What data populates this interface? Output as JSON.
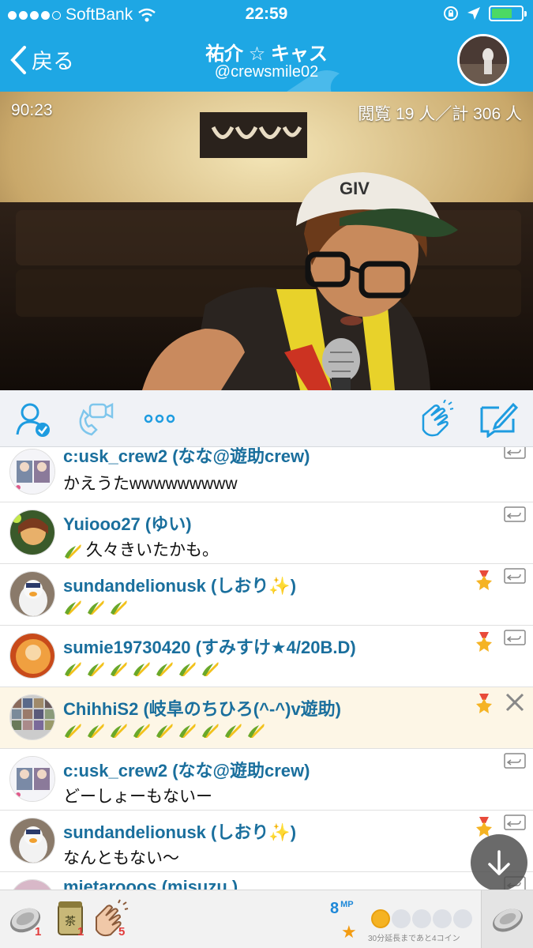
{
  "status_bar": {
    "carrier": "SoftBank",
    "time": "22:59"
  },
  "nav": {
    "back_label": "戻る",
    "title": "祐介 ☆ キャス",
    "subtitle": "@crewsmile02"
  },
  "video": {
    "elapsed": "90:23",
    "viewers": "閲覧 19 人／計 306 人"
  },
  "comments": [
    {
      "name": "c:usk_crew2 (なな@遊助crew)",
      "text": "かえうたwwwwwwwww",
      "corn": 0,
      "medal": false,
      "highlight": false
    },
    {
      "name": "Yuiooo27 (ゆい)",
      "text": "久々きいたかも。",
      "corn": 1,
      "medal": false,
      "highlight": false
    },
    {
      "name": "sundandelionusk (しおり✨)",
      "text": "",
      "corn": 3,
      "medal": true,
      "highlight": false
    },
    {
      "name": "sumie19730420 (すみすけ★4/20B.D)",
      "text": "",
      "corn": 7,
      "medal": true,
      "highlight": false
    },
    {
      "name": "ChihhiS2 (岐阜のちひろ(^-^)v遊助)",
      "text": "",
      "corn": 8,
      "medal": true,
      "highlight": true
    },
    {
      "name": "c:usk_crew2 (なな@遊助crew)",
      "text": "どーしょーもないー",
      "corn": 0,
      "medal": false,
      "highlight": false
    },
    {
      "name": "sundandelionusk (しおり✨)",
      "text": "なんともない〜",
      "corn": 0,
      "medal": true,
      "highlight": false
    },
    {
      "name": "mietarooos (misuzu.)",
      "text": "",
      "corn": 0,
      "medal": false,
      "highlight": false
    }
  ],
  "bottom_bar": {
    "item1_count": "1",
    "item2_count": "1",
    "item2_label": "茶",
    "item3_count": "5",
    "mp_value": "8",
    "mp_unit": "MP",
    "coin_text": "30分延長まであと4コイン"
  },
  "colors": {
    "brand": "#1ea7e4",
    "name": "#1a6f9d",
    "highlight_bg": "#fdf6e6"
  },
  "icons": {
    "toolbar": [
      "user-check-icon",
      "video-call-icon",
      "more-icon",
      "clap-icon",
      "compose-icon"
    ]
  }
}
